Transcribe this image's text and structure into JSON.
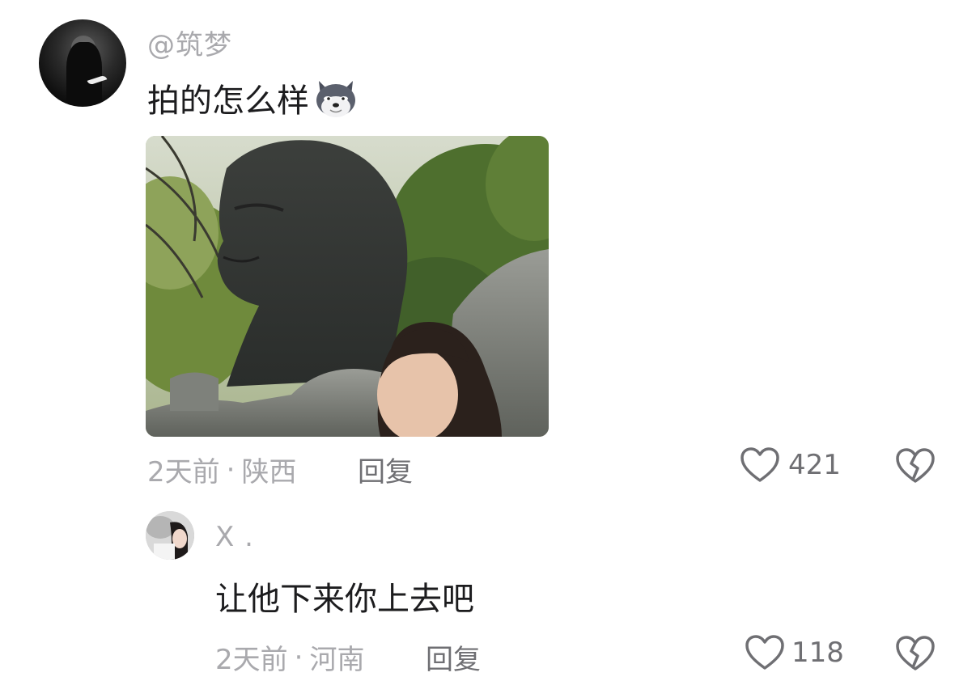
{
  "comment": {
    "username": "@筑梦",
    "text": "拍的怎么样",
    "emoji": "husky-dog-face-icon",
    "time": "2天前",
    "separator": "·",
    "location": "陕西",
    "reply_label": "回复",
    "likes": "421"
  },
  "reply": {
    "username": "X .",
    "text": "让他下来你上去吧",
    "time": "2天前",
    "separator": "·",
    "location": "河南",
    "reply_label": "回复",
    "likes": "118"
  },
  "colors": {
    "meta_text": "#a9a9ad",
    "primary_text": "#1c1c1e",
    "icon_stroke": "#6f6f73"
  }
}
